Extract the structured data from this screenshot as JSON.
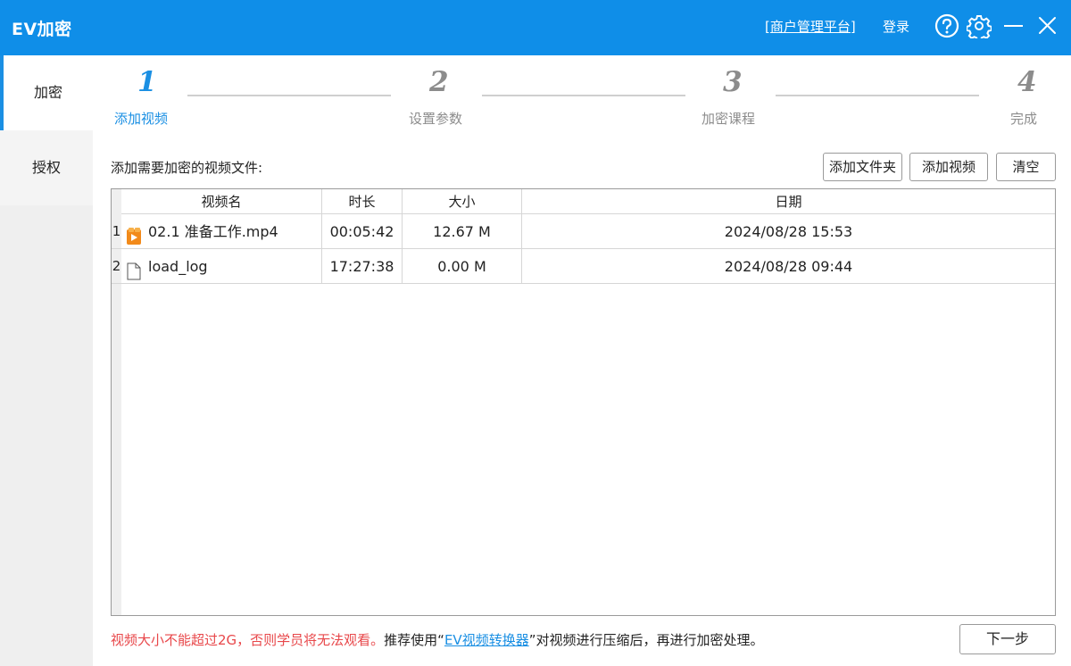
{
  "window": {
    "title": "EV加密",
    "merchant_link": "[商户管理平台]",
    "login_label": "登录",
    "icons": [
      "help-icon",
      "settings-icon",
      "minimize-icon",
      "close-icon"
    ],
    "accent_color": "#0f8ee8"
  },
  "sidebar": {
    "items": [
      {
        "label": "加密",
        "active": true
      },
      {
        "label": "授权",
        "active": false
      }
    ]
  },
  "steps": [
    {
      "number": "1",
      "label": "添加视频",
      "active": true
    },
    {
      "number": "2",
      "label": "设置参数",
      "active": false
    },
    {
      "number": "3",
      "label": "加密课程",
      "active": false
    },
    {
      "number": "4",
      "label": "完成",
      "active": false
    }
  ],
  "main": {
    "add_label": "添加需要加密的视频文件:",
    "buttons": {
      "add_folder": "添加文件夹",
      "add_video": "添加视频",
      "clear": "清空"
    }
  },
  "table": {
    "columns": [
      "视频名",
      "时长",
      "大小",
      "日期"
    ],
    "rows": [
      {
        "index": "1",
        "icon": "video-file-icon",
        "name": "02.1 准备工作.mp4",
        "duration": "00:05:42",
        "size": "12.67 M",
        "date": "2024/08/28 15:53"
      },
      {
        "index": "2",
        "icon": "blank-file-icon",
        "name": "load_log",
        "duration": "17:27:38",
        "size": "0.00 M",
        "date": "2024/08/28 09:44"
      }
    ]
  },
  "footer": {
    "warning": "视频大小不能超过2G，否则学员将无法观看。",
    "recommend_prefix": "推荐使用“",
    "converter_link": "EV视频转换器",
    "recommend_suffix": "”对视频进行压缩后，再进行加密处理。",
    "next_button": "下一步"
  }
}
